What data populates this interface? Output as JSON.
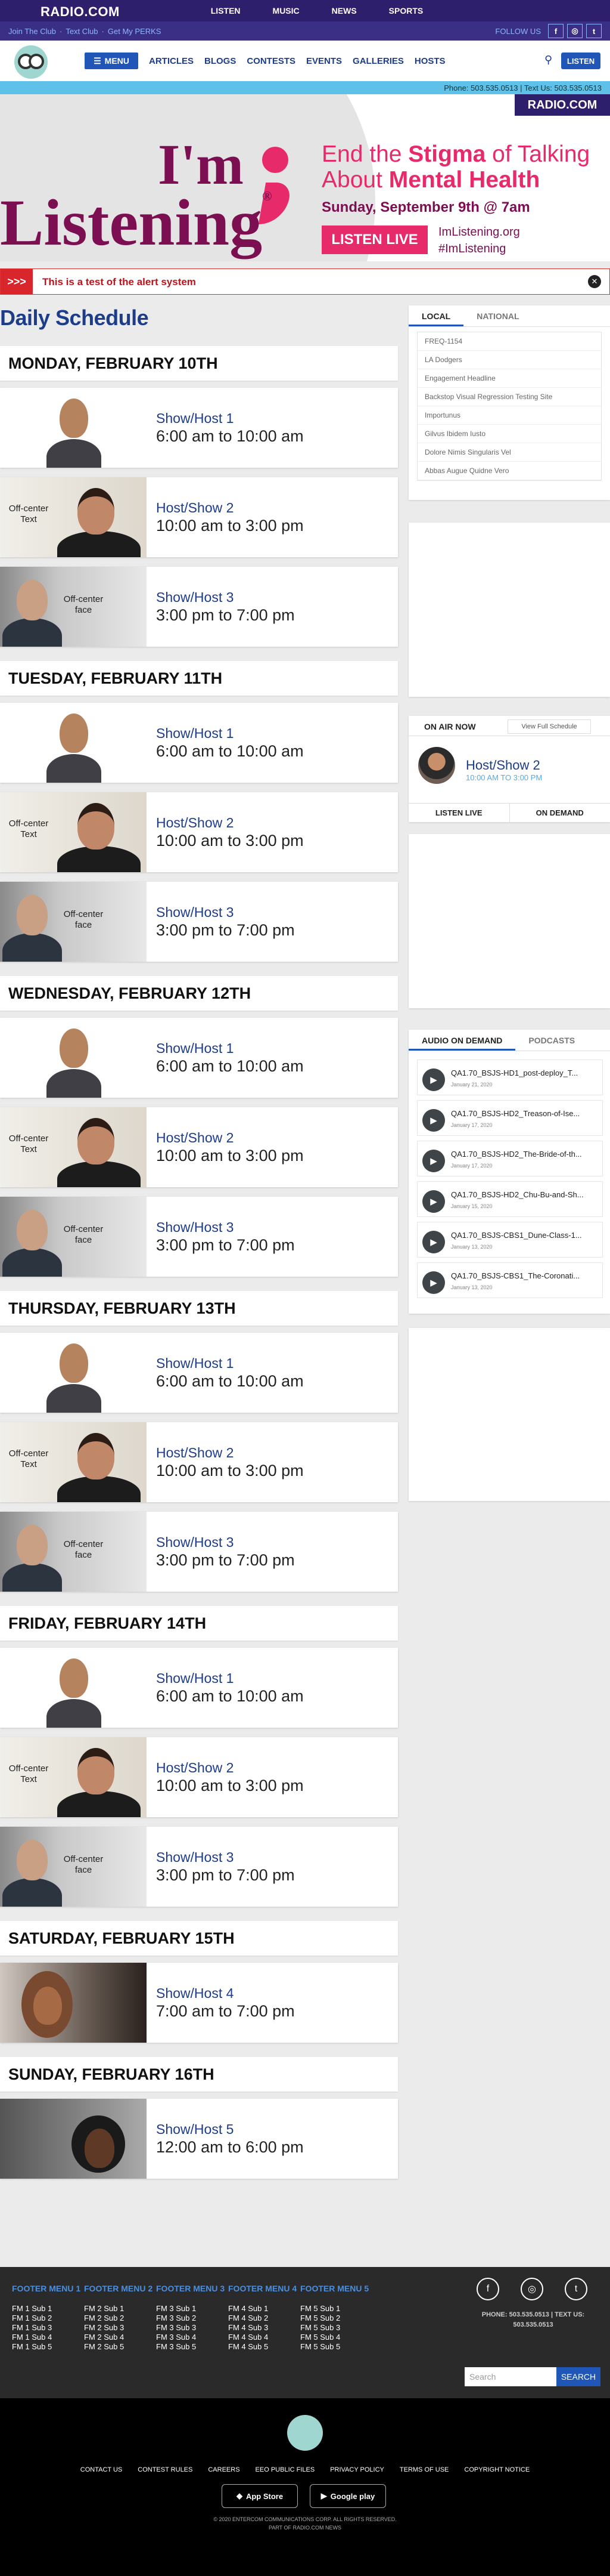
{
  "topbar": {
    "logo": "RADIO.COM",
    "nav": [
      "LISTEN",
      "MUSIC",
      "NEWS",
      "SPORTS"
    ]
  },
  "subbar": {
    "links": [
      "Join The Club",
      "Text Club",
      "Get My PERKS"
    ],
    "follow": "FOLLOW US"
  },
  "header": {
    "menu": "MENU",
    "nav": [
      "ARTICLES",
      "BLOGS",
      "CONTESTS",
      "EVENTS",
      "GALLERIES",
      "HOSTS"
    ],
    "listen": "LISTEN",
    "phone": "Phone: 503.535.0513 | Text Us: 503.535.0513"
  },
  "hero": {
    "brand": "RADIO.COM",
    "im": "I'm",
    "listening": "Listening",
    "t_a": "End the ",
    "t_b": "Stigma",
    "t_c": " of Talking About ",
    "t_d": "Mental Health",
    "date": "Sunday, September 9th @ 7am",
    "btn": "LISTEN LIVE",
    "url1": "ImListening.org",
    "url2": "#ImListening"
  },
  "alert": {
    "icon": ">>>",
    "text": "This is a test of the alert system",
    "close": "✕"
  },
  "schedule": {
    "title": "Daily Schedule",
    "days": [
      {
        "day": "MONDAY, FEBRUARY 10TH",
        "shows": [
          {
            "n": "Show/Host 1",
            "t": "6:00 am to 10:00 am"
          },
          {
            "n": "Host/Show 2",
            "t": "10:00 am to 3:00 pm"
          },
          {
            "n": "Show/Host 3",
            "t": "3:00 pm to 7:00 pm"
          }
        ]
      },
      {
        "day": "TUESDAY, FEBRUARY 11TH",
        "shows": [
          {
            "n": "Show/Host 1",
            "t": "6:00 am to 10:00 am"
          },
          {
            "n": "Host/Show 2",
            "t": "10:00 am to 3:00 pm"
          },
          {
            "n": "Show/Host 3",
            "t": "3:00 pm to 7:00 pm"
          }
        ]
      },
      {
        "day": "WEDNESDAY, FEBRUARY 12TH",
        "shows": [
          {
            "n": "Show/Host 1",
            "t": "6:00 am to 10:00 am"
          },
          {
            "n": "Host/Show 2",
            "t": "10:00 am to 3:00 pm"
          },
          {
            "n": "Show/Host 3",
            "t": "3:00 pm to 7:00 pm"
          }
        ]
      },
      {
        "day": "THURSDAY, FEBRUARY 13TH",
        "shows": [
          {
            "n": "Show/Host 1",
            "t": "6:00 am to 10:00 am"
          },
          {
            "n": "Host/Show 2",
            "t": "10:00 am to 3:00 pm"
          },
          {
            "n": "Show/Host 3",
            "t": "3:00 pm to 7:00 pm"
          }
        ]
      },
      {
        "day": "FRIDAY, FEBRUARY 14TH",
        "shows": [
          {
            "n": "Show/Host 1",
            "t": "6:00 am to 10:00 am"
          },
          {
            "n": "Host/Show 2",
            "t": "10:00 am to 3:00 pm"
          },
          {
            "n": "Show/Host 3",
            "t": "3:00 pm to 7:00 pm"
          }
        ]
      },
      {
        "day": "SATURDAY, FEBRUARY 15TH",
        "shows": [
          {
            "n": "Show/Host 4",
            "t": "7:00 am to 7:00 pm"
          }
        ]
      },
      {
        "day": "SUNDAY, FEBRUARY 16TH",
        "shows": [
          {
            "n": "Show/Host 5",
            "t": "12:00 am to 6:00 pm"
          }
        ]
      }
    ],
    "off_text": "Off-center Text",
    "off_face": "Off-center face"
  },
  "news": {
    "tabs": [
      "LOCAL",
      "NATIONAL"
    ],
    "items": [
      "FREQ-1154",
      "LA Dodgers",
      "Engagement Headline",
      "Backstop Visual Regression Testing Site",
      "Importunus",
      "Gilvus Ibidem Iusto",
      "Dolore Nimis Singularis Vel",
      "Abbas Augue Quidne Vero"
    ]
  },
  "onair": {
    "title": "ON AIR NOW",
    "full": "View Full Schedule",
    "show": "Host/Show 2",
    "time": "10:00 AM TO 3:00 PM",
    "b1": "LISTEN LIVE",
    "b2": "ON DEMAND"
  },
  "audio": {
    "tabs": [
      "AUDIO ON DEMAND",
      "PODCASTS"
    ],
    "items": [
      {
        "t": "QA1.70_BSJS-HD1_post-deploy_T...",
        "d": "January 21, 2020"
      },
      {
        "t": "QA1.70_BSJS-HD2_Treason-of-Ise...",
        "d": "January 17, 2020"
      },
      {
        "t": "QA1.70_BSJS-HD2_The-Bride-of-th...",
        "d": "January 17, 2020"
      },
      {
        "t": "QA1.70_BSJS-HD2_Chu-Bu-and-Sh...",
        "d": "January 15, 2020"
      },
      {
        "t": "QA1.70_BSJS-CBS1_Dune-Class-1...",
        "d": "January 13, 2020"
      },
      {
        "t": "QA1.70_BSJS-CBS1_The-Coronati...",
        "d": "January 13, 2020"
      }
    ]
  },
  "footer": {
    "cols": [
      {
        "h": "FOOTER MENU 1",
        "items": [
          "FM 1 Sub 1",
          "FM 1 Sub 2",
          "FM 1 Sub 3",
          "FM 1 Sub 4",
          "FM 1 Sub 5"
        ]
      },
      {
        "h": "FOOTER MENU 2",
        "items": [
          "FM 2 Sub 1",
          "FM 2 Sub 2",
          "FM 2 Sub 3",
          "FM 2 Sub 4",
          "FM 2 Sub 5"
        ]
      },
      {
        "h": "FOOTER MENU 3",
        "items": [
          "FM 3 Sub 1",
          "FM 3 Sub 2",
          "FM 3 Sub 3",
          "FM 3 Sub 4",
          "FM 3 Sub 5"
        ]
      },
      {
        "h": "FOOTER MENU 4",
        "items": [
          "FM 4 Sub 1",
          "FM 4 Sub 2",
          "FM 4 Sub 3",
          "FM 4 Sub 4",
          "FM 4 Sub 5"
        ]
      },
      {
        "h": "FOOTER MENU 5",
        "items": [
          "FM 5 Sub 1",
          "FM 5 Sub 2",
          "FM 5 Sub 3",
          "FM 5 Sub 4",
          "FM 5 Sub 5"
        ]
      }
    ],
    "phone": "PHONE: 503.535.0513 | TEXT US: 503.535.0513",
    "search_ph": "Search",
    "search_btn": "SEARCH"
  },
  "bottom": {
    "links": [
      "CONTACT US",
      "CONTEST RULES",
      "CAREERS",
      "EEO PUBLIC FILES",
      "PRIVACY POLICY",
      "TERMS OF USE",
      "COPYRIGHT NOTICE"
    ],
    "app1": "App Store",
    "app2": "Google play",
    "copy1": "© 2020 ENTERCOM COMMUNICATIONS CORP. ALL RIGHTS RESERVED.",
    "copy2": "PART OF RADIO.COM NEWS"
  },
  "colors": {
    "navy": "#2d1f6b",
    "blue": "#1f56b8",
    "pink": "#e62a6a",
    "plum": "#7c0f51",
    "alert": "#d9262c"
  }
}
